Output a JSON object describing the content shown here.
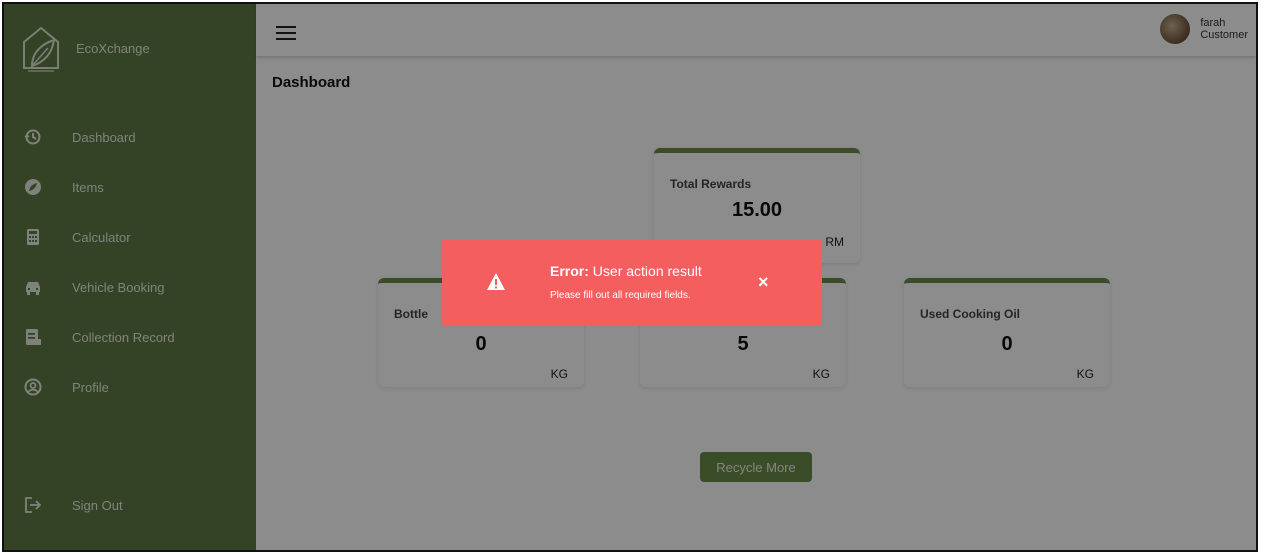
{
  "app": {
    "name": "EcoXchange"
  },
  "sidebar": {
    "items": [
      {
        "label": "Dashboard",
        "icon": "history-icon"
      },
      {
        "label": "Items",
        "icon": "leaf-icon"
      },
      {
        "label": "Calculator",
        "icon": "calculator-icon"
      },
      {
        "label": "Vehicle Booking",
        "icon": "car-icon"
      },
      {
        "label": "Collection Record",
        "icon": "receipt-icon"
      },
      {
        "label": "Profile",
        "icon": "user-circle-icon"
      }
    ],
    "sign_out": "Sign Out"
  },
  "user": {
    "name": "farah",
    "role": "Customer"
  },
  "page": {
    "title": "Dashboard"
  },
  "cards": {
    "total_rewards": {
      "label": "Total Rewards",
      "value": "15.00",
      "unit": "RM"
    },
    "bottle": {
      "label": "Bottle",
      "value": "0",
      "unit": "KG"
    },
    "middle": {
      "value": "5",
      "unit": "KG"
    },
    "used_cooking_oil": {
      "label": "Used Cooking Oil",
      "value": "0",
      "unit": "KG"
    }
  },
  "recycle_button": "Recycle More",
  "toast": {
    "title_prefix": "Error:",
    "title": "User action result",
    "message": "Please fill out all required fields.",
    "close": "×",
    "color": "#f45e5e"
  },
  "colors": {
    "sidebar": "#5f7a45",
    "accent": "#6c8a4c"
  }
}
